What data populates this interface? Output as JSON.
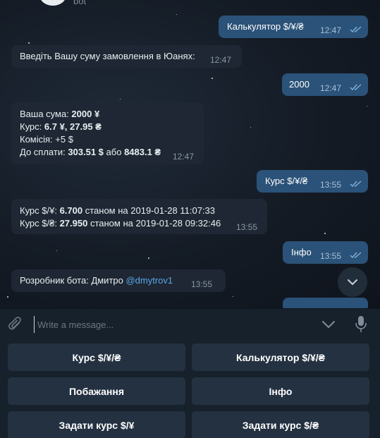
{
  "header": {
    "bot_name_fragment": "bot"
  },
  "messages": [
    {
      "dir": "out",
      "text": "Калькулятор $/¥/₴",
      "time": "12:47"
    },
    {
      "dir": "in",
      "text": "Введіть Вашу суму замовлення в Юанях:",
      "time": "12:47"
    },
    {
      "dir": "out",
      "text": "2000",
      "time": "12:47"
    },
    {
      "dir": "in",
      "lines": [
        {
          "label": "Ваша сума: ",
          "value": "2000 ¥",
          "rest": ""
        },
        {
          "label": "Курс: ",
          "value": "6.7 ¥, 27.95 ₴",
          "rest": ""
        },
        {
          "label": "Комісія: +5 $",
          "value": "",
          "rest": ""
        },
        {
          "label": "До сплати: ",
          "value": "303.51 $",
          "mid": " або ",
          "value2": "8483.1 ₴"
        }
      ],
      "time": "12:47"
    },
    {
      "dir": "out",
      "text": "Курс $/¥/₴",
      "time": "13:55"
    },
    {
      "dir": "in",
      "lines": [
        {
          "label": "Курс $/¥: ",
          "value": "6.700",
          "rest": " станом на 2019-01-28 11:07:33"
        },
        {
          "label": "Курс $/₴: ",
          "value": "27.950",
          "rest": " станом на 2019-01-28 09:32:46"
        }
      ],
      "time": "13:55"
    },
    {
      "dir": "out",
      "text": "Інфо",
      "time": "13:55"
    },
    {
      "dir": "in",
      "prefix": "Розробник бота: Дмитро ",
      "link": "@dmytrov1",
      "time": "13:55"
    }
  ],
  "composer": {
    "placeholder": "Write a message..."
  },
  "keyboard": [
    "Курс $/¥/₴",
    "Калькулятор $/¥/₴",
    "Побажання",
    "Інфо",
    "Задати курс $/¥",
    "Задати курс $/₴"
  ],
  "colors": {
    "outgoing_bubble": "#2b5278",
    "incoming_bubble": "#1e2733",
    "link": "#5aa6e6",
    "keyboard_button": "#243141"
  },
  "icons": [
    "attach-icon",
    "chevron-down-icon",
    "microphone-icon",
    "double-check-icon",
    "scroll-down-icon"
  ]
}
